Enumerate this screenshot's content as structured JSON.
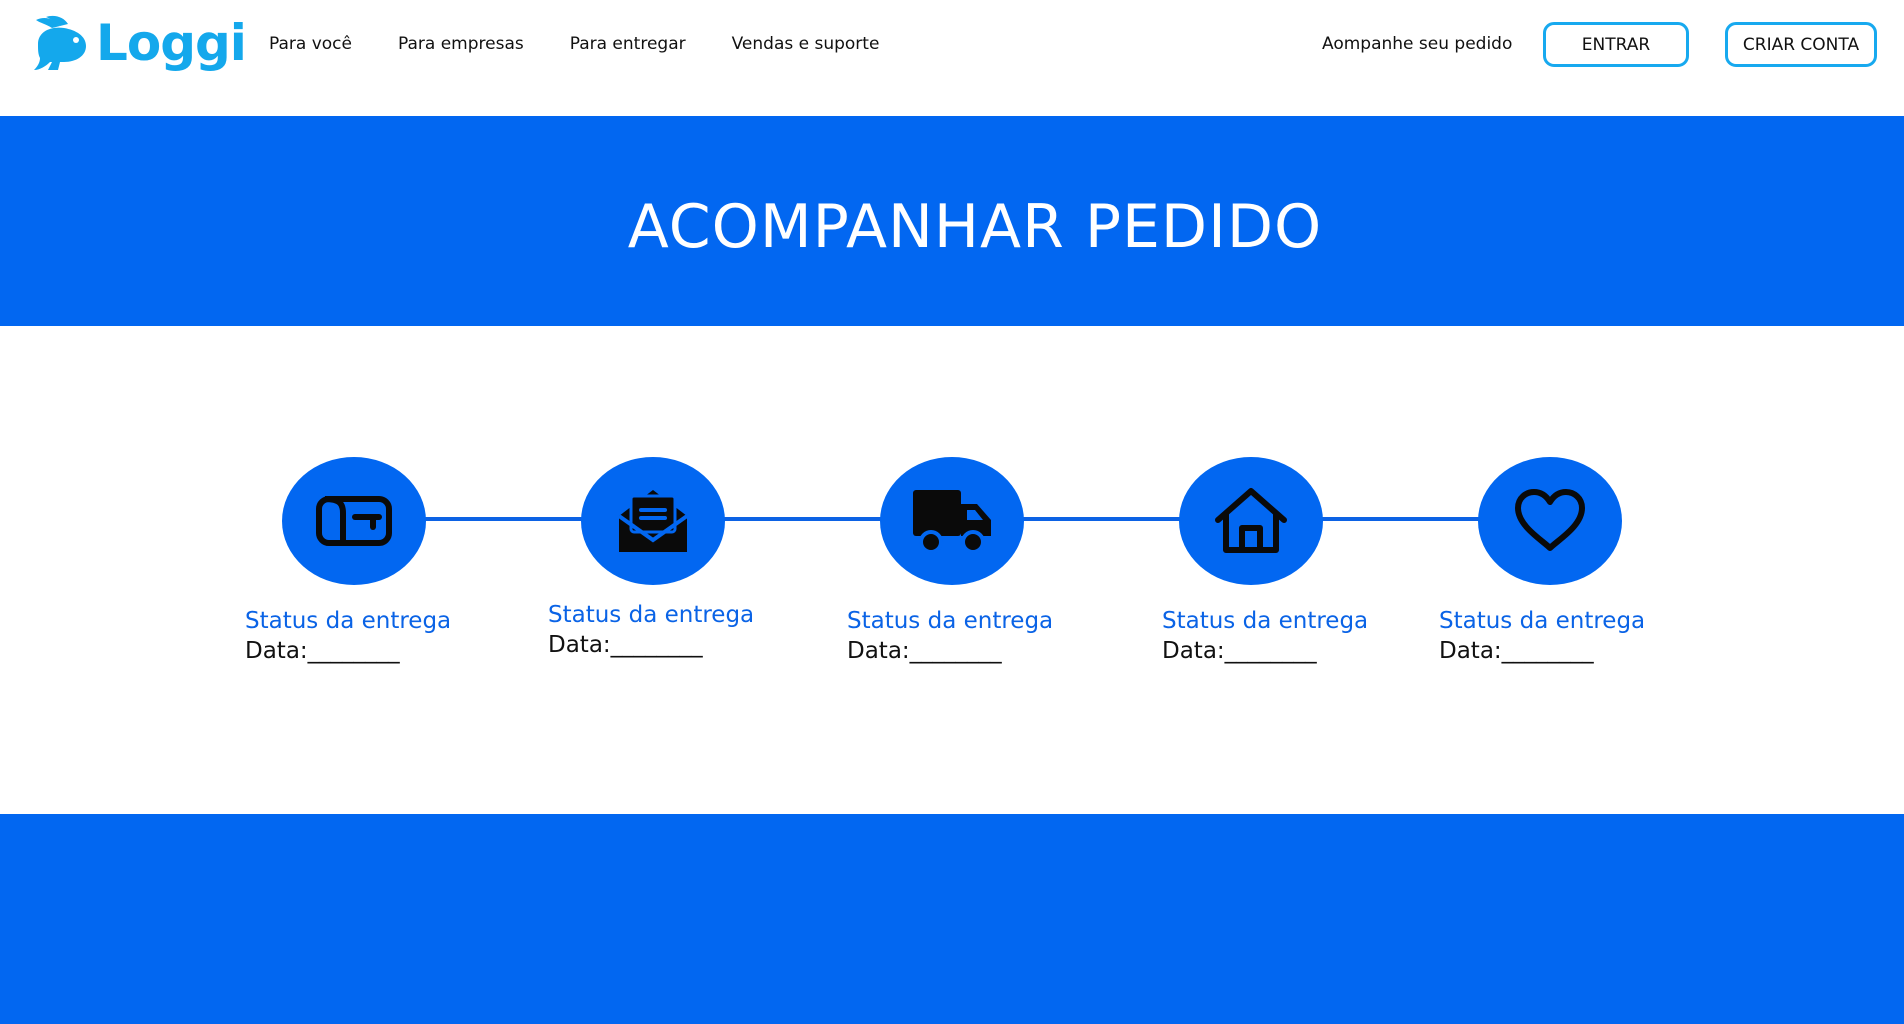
{
  "brand": {
    "name": "Loggi",
    "color": "#14a8ec"
  },
  "nav": {
    "items": [
      {
        "label": "Para você"
      },
      {
        "label": "Para empresas"
      },
      {
        "label": "Para entregar"
      },
      {
        "label": "Vendas e suporte"
      }
    ],
    "track_link": "Aompanhe seu pedido",
    "enter_label": "ENTRAR",
    "create_label": "CRIAR CONTA"
  },
  "hero": {
    "title": "ACOMPANHAR PEDIDO",
    "background": "#0267f1"
  },
  "timeline": {
    "steps": [
      {
        "icon": "mailbox-icon",
        "status": "Status da entrega",
        "date": "Data:________"
      },
      {
        "icon": "open-envelope-icon",
        "status": "Status da entrega",
        "date": "Data:________"
      },
      {
        "icon": "truck-icon",
        "status": "Status da entrega",
        "date": "Data:________"
      },
      {
        "icon": "home-icon",
        "status": "Status da entrega",
        "date": "Data:________"
      },
      {
        "icon": "heart-icon",
        "status": "Status da entrega",
        "date": "Data:________"
      }
    ]
  },
  "colors": {
    "accent": "#0267f1",
    "status_text": "#0a63e6",
    "button_border": "#17a9ef"
  }
}
